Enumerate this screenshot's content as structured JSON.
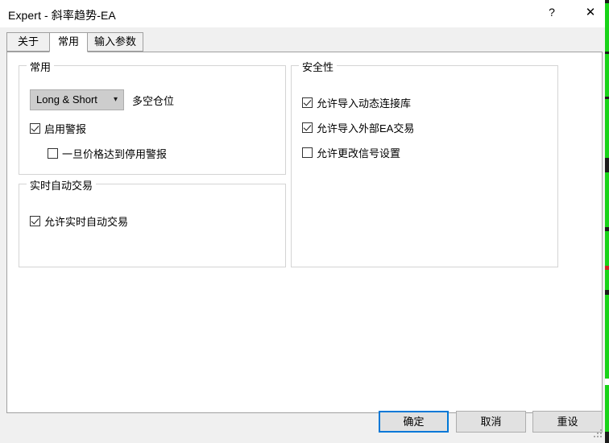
{
  "window": {
    "title": "Expert - 斜率趋势-EA",
    "help_button": "?",
    "close_button": "✕",
    "colors": {
      "titlebar_bg": "#ffffff",
      "dialog_bg": "#f0f0f0",
      "panel_bg": "#ffffff",
      "accent_focus": "#0078d7",
      "group_border": "#d4d4d4",
      "button_face": "#e1e1e1",
      "combo_face": "#cdcdcd",
      "edge_artifact": "#18d318"
    }
  },
  "tabs": [
    {
      "label": "关于",
      "selected": false
    },
    {
      "label": "常用",
      "selected": true
    },
    {
      "label": "输入参数",
      "selected": false
    }
  ],
  "groups": {
    "general": {
      "title": "常用",
      "combo": {
        "value": "Long & Short",
        "arrow_icon": "chevron-down-icon",
        "label": "多空仓位"
      },
      "checkboxes": [
        {
          "label": "启用警报",
          "checked": true
        },
        {
          "label": "一旦价格达到停用警报",
          "checked": false
        }
      ]
    },
    "realtime": {
      "title": "实时自动交易",
      "checkboxes": [
        {
          "label": "允许实时自动交易",
          "checked": true
        }
      ]
    },
    "security": {
      "title": "安全性",
      "checkboxes": [
        {
          "label": "允许导入动态连接库",
          "checked": true
        },
        {
          "label": "允许导入外部EA交易",
          "checked": true
        },
        {
          "label": "允许更改信号设置",
          "checked": false
        }
      ]
    }
  },
  "footer": {
    "ok_label": "确定",
    "cancel_label": "取消",
    "reset_label": "重设"
  }
}
